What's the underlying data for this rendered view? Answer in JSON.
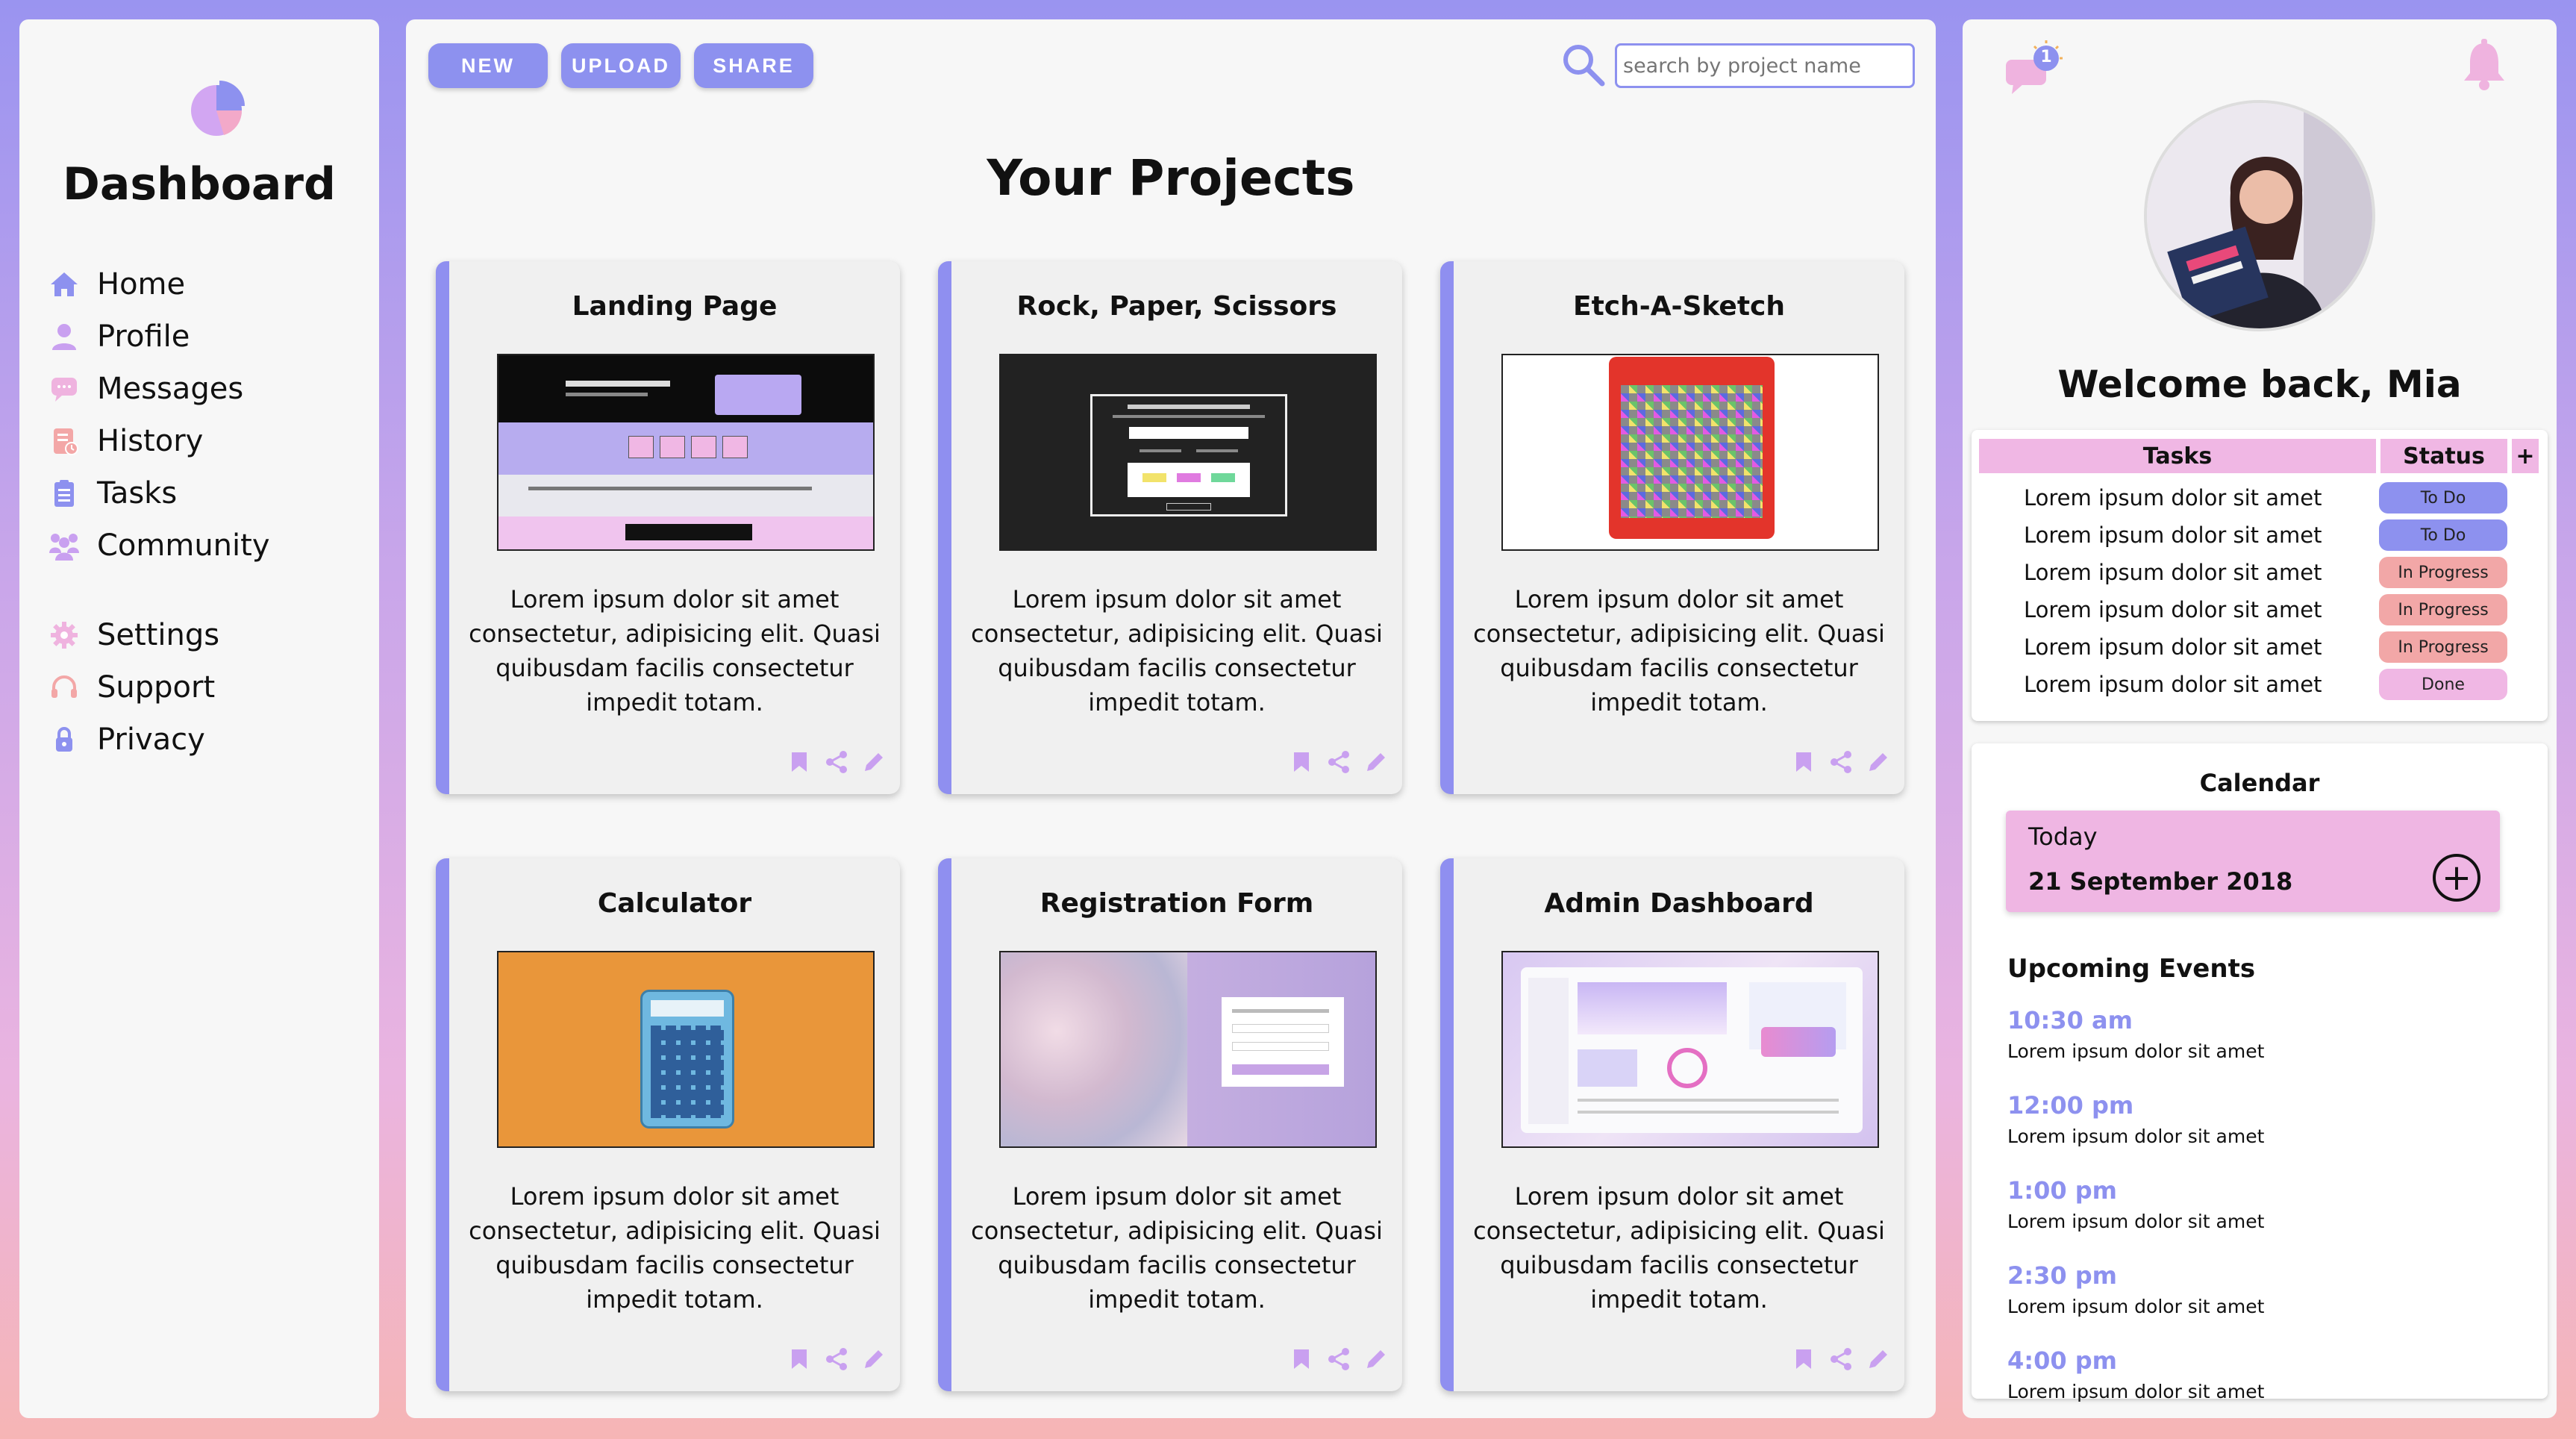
{
  "sidebar": {
    "title": "Dashboard",
    "nav": [
      {
        "label": "Home",
        "icon": "home-icon"
      },
      {
        "label": "Profile",
        "icon": "user-icon"
      },
      {
        "label": "Messages",
        "icon": "message-icon"
      },
      {
        "label": "History",
        "icon": "history-icon"
      },
      {
        "label": "Tasks",
        "icon": "clipboard-icon"
      },
      {
        "label": "Community",
        "icon": "people-icon"
      }
    ],
    "nav2": [
      {
        "label": "Settings",
        "icon": "gear-icon"
      },
      {
        "label": "Support",
        "icon": "headset-icon"
      },
      {
        "label": "Privacy",
        "icon": "lock-icon"
      }
    ]
  },
  "toolbar": {
    "new_label": "NEW",
    "upload_label": "UPLOAD",
    "share_label": "SHARE",
    "search_placeholder": "search by project name"
  },
  "main": {
    "title": "Your Projects",
    "projects": [
      {
        "title": "Landing Page",
        "desc": "Lorem ipsum dolor sit amet consectetur, adipisicing elit. Quasi quibusdam facilis consectetur impedit totam."
      },
      {
        "title": "Rock, Paper, Scissors",
        "desc": "Lorem ipsum dolor sit amet consectetur, adipisicing elit. Quasi quibusdam facilis consectetur impedit totam."
      },
      {
        "title": "Etch-A-Sketch",
        "desc": "Lorem ipsum dolor sit amet consectetur, adipisicing elit. Quasi quibusdam facilis consectetur impedit totam."
      },
      {
        "title": "Calculator",
        "desc": "Lorem ipsum dolor sit amet consectetur, adipisicing elit. Quasi quibusdam facilis consectetur impedit totam."
      },
      {
        "title": "Registration Form",
        "desc": "Lorem ipsum dolor sit amet consectetur, adipisicing elit. Quasi quibusdam facilis consectetur impedit totam."
      },
      {
        "title": "Admin Dashboard",
        "desc": "Lorem ipsum dolor sit amet consectetur, adipisicing elit. Quasi quibusdam facilis consectetur impedit totam."
      }
    ]
  },
  "right": {
    "notification_count": "1",
    "welcome": "Welcome back, Mia",
    "tasks_header": "Tasks",
    "status_header": "Status",
    "add_label": "+",
    "tasks": [
      {
        "text": "Lorem ipsum dolor sit amet",
        "status": "To Do",
        "color": "#8d91ef"
      },
      {
        "text": "Lorem ipsum dolor sit amet",
        "status": "To Do",
        "color": "#8d91ef"
      },
      {
        "text": "Lorem ipsum dolor sit amet",
        "status": "In Progress",
        "color": "#f2a7a7"
      },
      {
        "text": "Lorem ipsum dolor sit amet",
        "status": "In Progress",
        "color": "#f2a7a7"
      },
      {
        "text": "Lorem ipsum dolor sit amet",
        "status": "In Progress",
        "color": "#f2a7a7"
      },
      {
        "text": "Lorem ipsum dolor sit amet",
        "status": "Done",
        "color": "#f0b7e4"
      }
    ],
    "calendar": {
      "title": "Calendar",
      "today_label": "Today",
      "today_date": "21 September 2018",
      "add_label": "+",
      "upcoming_title": "Upcoming Events",
      "events": [
        {
          "time": "10:30 am",
          "desc": "Lorem ipsum dolor sit amet"
        },
        {
          "time": "12:00 pm",
          "desc": "Lorem ipsum dolor sit amet"
        },
        {
          "time": "1:00 pm",
          "desc": "Lorem ipsum dolor sit amet"
        },
        {
          "time": "2:30 pm",
          "desc": "Lorem ipsum dolor sit amet"
        },
        {
          "time": "4:00 pm",
          "desc": "Lorem ipsum dolor sit amet"
        }
      ]
    }
  },
  "colors": {
    "accent": "#8d91ef",
    "pink": "#f0b7e4",
    "salmon": "#f2a7a7"
  }
}
